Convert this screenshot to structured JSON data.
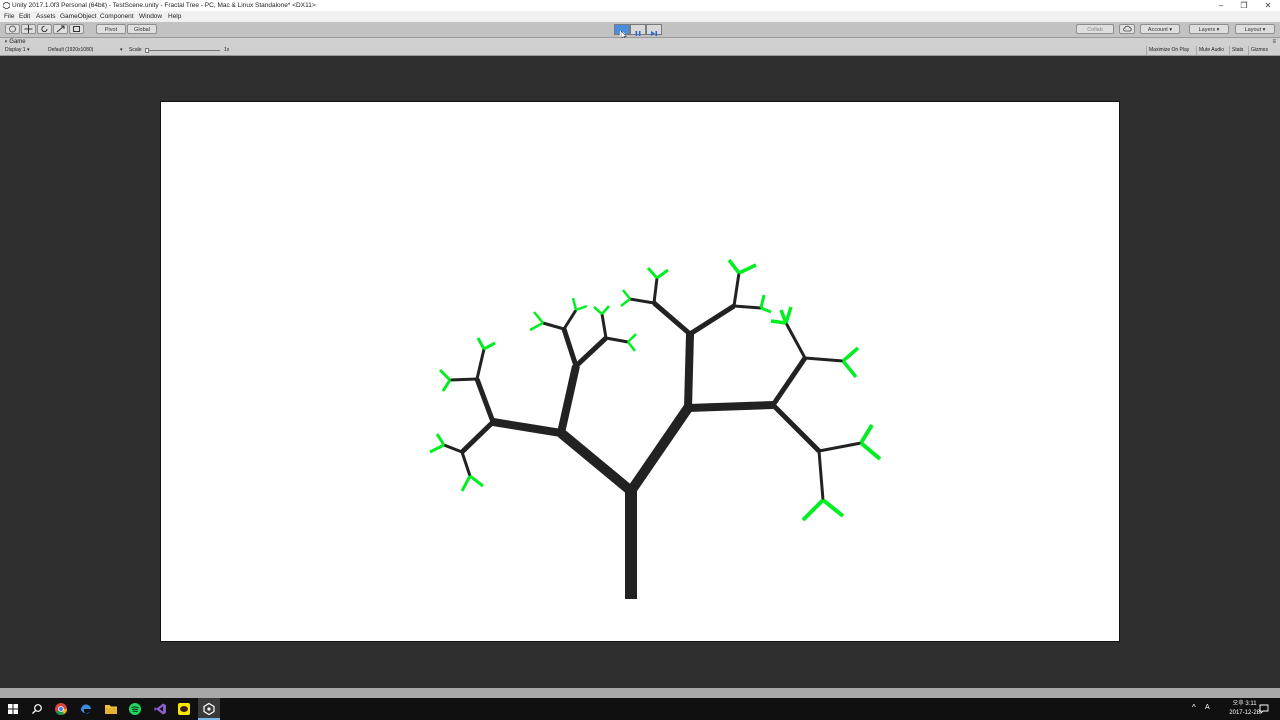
{
  "window": {
    "title": "Unity 2017.1.0f3 Personal (64bit) - TestScene.unity - Fractal Tree - PC, Mac & Linux Standalone* <DX11>",
    "minimize": "–",
    "maximize": "❐",
    "close": "✕"
  },
  "menu": [
    "File",
    "Edit",
    "Assets",
    "GameObject",
    "Component",
    "Window",
    "Help"
  ],
  "toolbar": {
    "pivot": "Pivot",
    "global": "Global",
    "collab": "Collab",
    "account": "Account",
    "layers": "Layers",
    "layout": "Layout"
  },
  "game": {
    "tab": "Game",
    "display": "Display 1",
    "resolution": "Default (1920x1080)",
    "scale_label": "Scale",
    "scale_value": "1x",
    "maximize_on_play": "Maximize On Play",
    "mute_audio": "Mute Audio",
    "stats": "Stats",
    "gizmos": "Gizmos"
  },
  "colors": {
    "branch": "#222222",
    "leaf": "#00ee22",
    "play_active": "#4a8ee0"
  },
  "taskbar": {
    "time": "오후 3:11",
    "date": "2017-12-28",
    "lang": "A"
  }
}
